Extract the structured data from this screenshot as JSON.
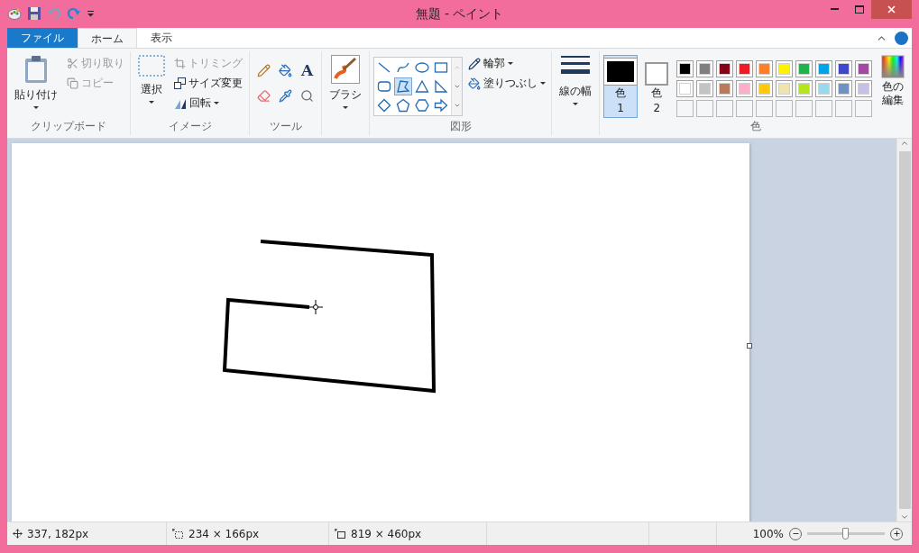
{
  "window": {
    "title": "無題 - ペイント"
  },
  "tabs": [
    {
      "label": "ファイル",
      "kind": "file",
      "selected": false
    },
    {
      "label": "ホーム",
      "kind": "tab",
      "selected": true
    },
    {
      "label": "表示",
      "kind": "tab",
      "selected": false
    }
  ],
  "clipboard": {
    "paste": "貼り付け",
    "cut": {
      "label": "切り取り",
      "disabled": true
    },
    "copy": {
      "label": "コピー",
      "disabled": true
    },
    "group_label": "クリップボード"
  },
  "image": {
    "select": "選択",
    "crop": {
      "label": "トリミング",
      "disabled": true
    },
    "resize": {
      "label": "サイズ変更",
      "disabled": false
    },
    "rotate": {
      "label": "回転",
      "disabled": false
    },
    "group_label": "イメージ"
  },
  "tools": {
    "group_label": "ツール",
    "text_tool": "A"
  },
  "brush": {
    "label": "ブラシ"
  },
  "shapes": {
    "items": [
      {
        "kind": "line",
        "selected": false
      },
      {
        "kind": "curve",
        "selected": false
      },
      {
        "kind": "oval",
        "selected": false
      },
      {
        "kind": "rectangle",
        "selected": false
      },
      {
        "kind": "rounded-rectangle",
        "selected": false
      },
      {
        "kind": "polygon",
        "selected": true
      },
      {
        "kind": "triangle",
        "selected": false
      },
      {
        "kind": "right-triangle",
        "selected": false
      },
      {
        "kind": "diamond",
        "selected": false
      },
      {
        "kind": "pentagon",
        "selected": false
      },
      {
        "kind": "hexagon",
        "selected": false
      },
      {
        "kind": "arrow",
        "selected": false
      }
    ],
    "outline": "輪郭",
    "fill": "塗りつぶし",
    "group_label": "図形"
  },
  "line_width": {
    "label": "線の幅"
  },
  "colors": {
    "slots": [
      {
        "label": "色",
        "number": "1",
        "color": "#000000",
        "selected": true
      },
      {
        "label": "色",
        "number": "2",
        "color": "#ffffff",
        "selected": false
      }
    ],
    "palette": [
      {
        "color": "#000000"
      },
      {
        "color": "#7f7f7f"
      },
      {
        "color": "#880015"
      },
      {
        "color": "#ed1c24"
      },
      {
        "color": "#ff7f27"
      },
      {
        "color": "#fff200"
      },
      {
        "color": "#22b14c"
      },
      {
        "color": "#00a2e8"
      },
      {
        "color": "#3f48cc"
      },
      {
        "color": "#a349a4"
      },
      {
        "color": "#ffffff"
      },
      {
        "color": "#c3c3c3"
      },
      {
        "color": "#b97a57"
      },
      {
        "color": "#ffaec9"
      },
      {
        "color": "#ffc90e"
      },
      {
        "color": "#efe4b0"
      },
      {
        "color": "#b5e61d"
      },
      {
        "color": "#99d9ea"
      },
      {
        "color": "#7092be"
      },
      {
        "color": "#c8bfe7"
      }
    ],
    "edit_label": "色の編集",
    "group_label": "色"
  },
  "status_bar": {
    "position": "337, 182px",
    "selection": "234 × 166px",
    "canvas_size": "819 × 460px",
    "zoom": "100%",
    "zoom_slider": {
      "level": 0.5
    }
  }
}
